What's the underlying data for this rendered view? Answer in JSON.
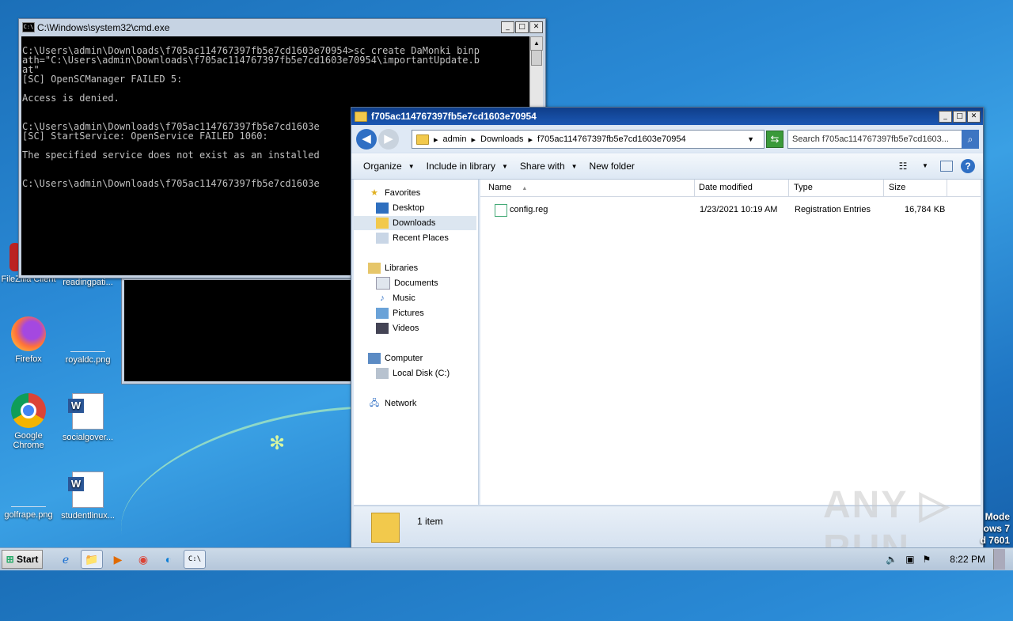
{
  "desktop": {
    "icons": [
      {
        "label": "FileZilla Client"
      },
      {
        "label": "readingpati..."
      },
      {
        "label": "Firefox"
      },
      {
        "label": "royaldc.png"
      },
      {
        "label": "Google Chrome"
      },
      {
        "label": "socialgover..."
      },
      {
        "label": "golfrape.png"
      },
      {
        "label": "studentlinux..."
      }
    ],
    "watermark": "ANY ▷ RUN",
    "winmode": [
      "Mode",
      "ows 7",
      "d 7601"
    ]
  },
  "cmd": {
    "title": "C:\\Windows\\system32\\cmd.exe",
    "lines": [
      "C:\\Users\\admin\\Downloads\\f705ac114767397fb5e7cd1603e70954>sc create DaMonki binp",
      "ath=\"C:\\Users\\admin\\Downloads\\f705ac114767397fb5e7cd1603e70954\\importantUpdate.b",
      "at\"",
      "[SC] OpenSCManager FAILED 5:",
      "",
      "Access is denied.",
      "",
      "",
      "C:\\Users\\admin\\Downloads\\f705ac114767397fb5e7cd1603e",
      "[SC] StartService: OpenService FAILED 1060:",
      "",
      "The specified service does not exist as an installed",
      "",
      "",
      "C:\\Users\\admin\\Downloads\\f705ac114767397fb5e7cd1603e"
    ]
  },
  "explorer": {
    "title": "f705ac114767397fb5e7cd1603e70954",
    "breadcrumb": [
      "admin",
      "Downloads",
      "f705ac114767397fb5e7cd1603e70954"
    ],
    "search_placeholder": "Search f705ac114767397fb5e7cd1603...",
    "toolbar": {
      "organize": "Organize",
      "include": "Include in library",
      "share": "Share with",
      "newfolder": "New folder"
    },
    "nav": {
      "favorites": "Favorites",
      "desktop": "Desktop",
      "downloads": "Downloads",
      "recent": "Recent Places",
      "libraries": "Libraries",
      "documents": "Documents",
      "music": "Music",
      "pictures": "Pictures",
      "videos": "Videos",
      "computer": "Computer",
      "localdisk": "Local Disk (C:)",
      "network": "Network"
    },
    "columns": {
      "name": "Name",
      "date": "Date modified",
      "type": "Type",
      "size": "Size"
    },
    "files": [
      {
        "name": "config.reg",
        "date": "1/23/2021 10:19 AM",
        "type": "Registration Entries",
        "size": "16,784 KB"
      }
    ],
    "status": "1 item"
  },
  "taskbar": {
    "start": "Start",
    "clock": "8:22 PM"
  }
}
